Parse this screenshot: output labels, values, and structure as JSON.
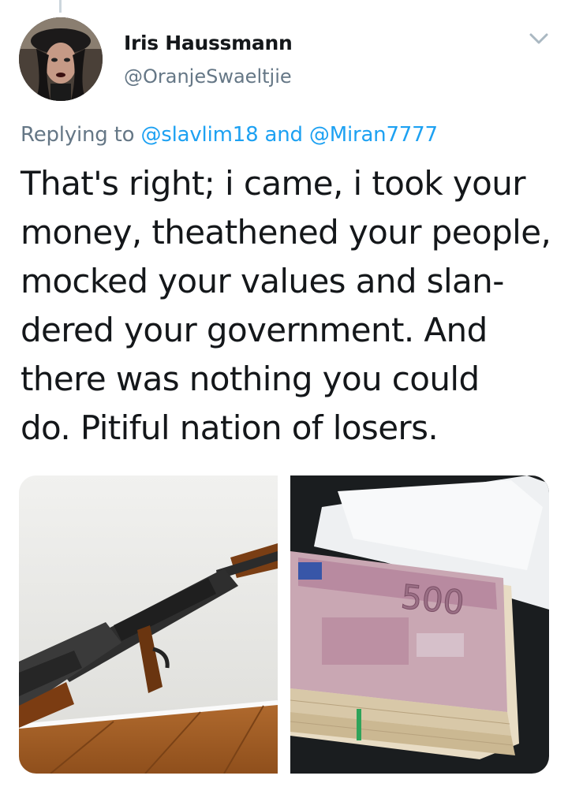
{
  "tweet": {
    "author_name": "Iris Haussmann",
    "author_handle": "@OranjeSwaeltjie",
    "replying_prefix": "Replying to",
    "reply_to_1": "@slavlim18",
    "reply_joiner": "and",
    "reply_to_2": "@Miran7777",
    "text_lines": [
      "That's right; i came, i took your",
      "money, theathened your people,",
      "mocked your values and slan-",
      "dered your government. And",
      "there was nothing you could",
      "do. Pitiful nation of losers."
    ],
    "media": [
      {
        "alt": "rifle-photo"
      },
      {
        "alt": "euro-banknotes-photo",
        "note_value": "500"
      }
    ]
  },
  "icons": {
    "caret": "chevron-down-icon"
  },
  "colors": {
    "text": "#14171a",
    "secondary": "#657786",
    "link": "#1da1f2"
  }
}
